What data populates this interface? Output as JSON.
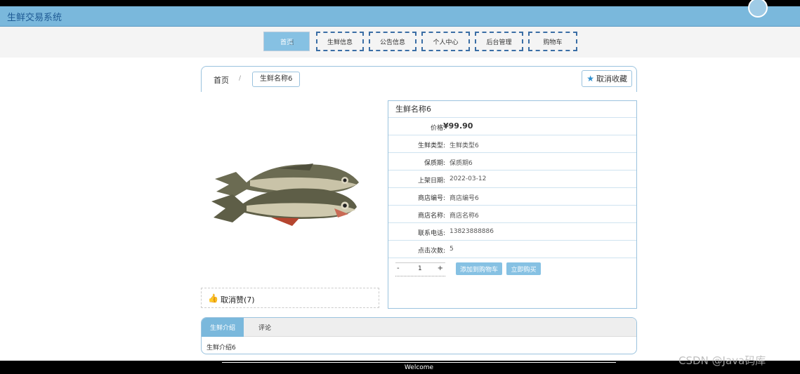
{
  "header": {
    "app_title": "生鲜交易系统"
  },
  "nav": {
    "items": [
      "首页",
      "生鲜信息",
      "公告信息",
      "个人中心",
      "后台管理",
      "购物车"
    ]
  },
  "breadcrumb": {
    "home": "首页",
    "separator": "/",
    "current": "生鲜名称6"
  },
  "favorite": {
    "label": "取消收藏"
  },
  "product": {
    "name": "生鲜名称6",
    "price_label": "价格:",
    "price": "¥99.90",
    "fields": [
      {
        "label": "生鲜类型:",
        "value": "生鲜类型6"
      },
      {
        "label": "保质期:",
        "value": "保质期6"
      },
      {
        "label": "上架日期:",
        "value": "2022-03-12"
      },
      {
        "label": "商店编号:",
        "value": "商店编号6"
      },
      {
        "label": "商店名称:",
        "value": "商店名称6"
      },
      {
        "label": "联系电话:",
        "value": "13823888886"
      },
      {
        "label": "点击次数:",
        "value": "5"
      }
    ],
    "quantity": "1",
    "add_to_cart": "添加到购物车",
    "buy_now": "立即购买"
  },
  "like": {
    "label": "取消赞(7)"
  },
  "tabs": {
    "intro": "生鲜介绍",
    "comments": "评论",
    "intro_content": "生鲜介绍6"
  },
  "footer": {
    "welcome": "Welcome"
  },
  "watermark": "CSDN @Java码库",
  "colors": {
    "header_bg": "#7ab8dc",
    "accent": "#86c1e3",
    "nav_border": "#3a6ea5"
  }
}
